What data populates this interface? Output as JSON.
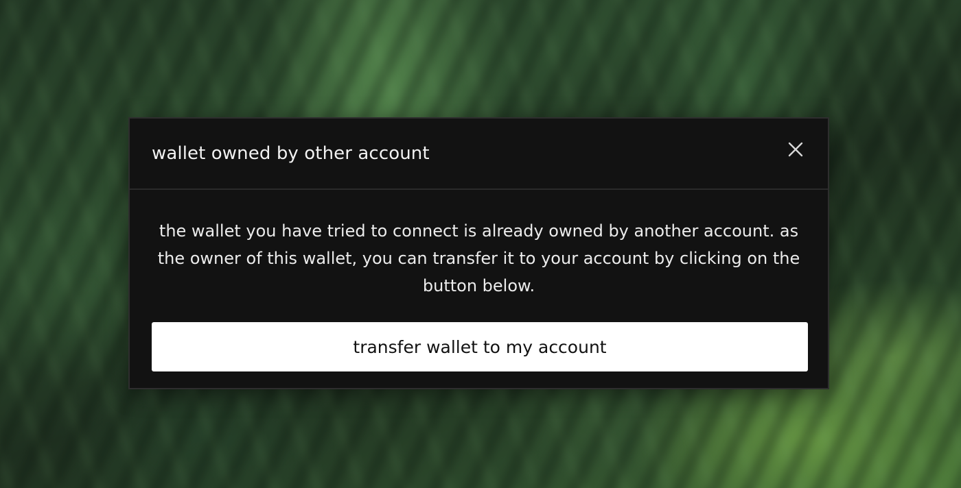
{
  "modal": {
    "title": "wallet owned by other account",
    "close_icon": "close-icon",
    "message": "the wallet you have tried to connect is already owned by another account. as the owner of this wallet, you can transfer it to your account by clicking on the button below.",
    "button_label": "transfer wallet to my account"
  },
  "colors": {
    "modal_background": "#121212",
    "button_background": "#ffffff",
    "text": "#f2f2f2"
  }
}
